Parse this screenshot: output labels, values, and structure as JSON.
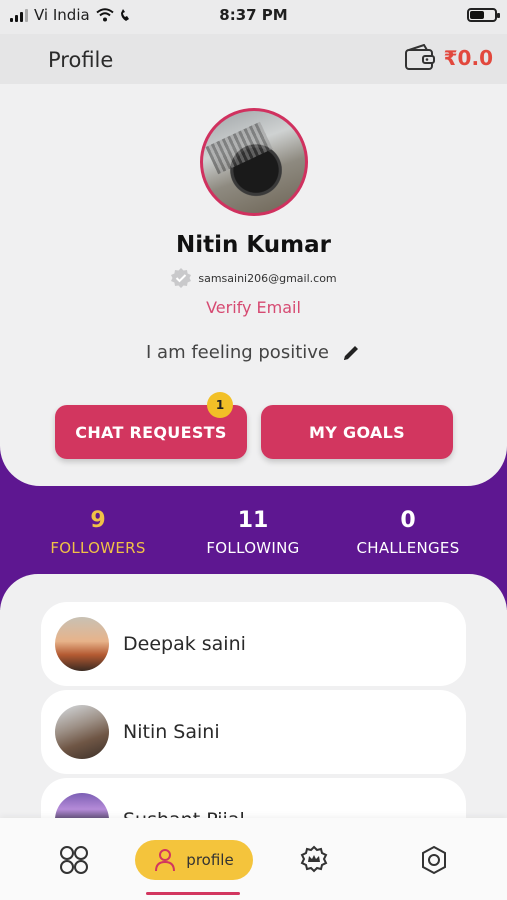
{
  "status_bar": {
    "carrier": "Vi India",
    "time": "8:37 PM",
    "battery_level": 0.6
  },
  "header": {
    "title": "Profile",
    "wallet_icon": "wallet-icon",
    "wallet_amount": "₹0.0"
  },
  "profile": {
    "name": "Nitin Kumar",
    "email": "samsaini206@gmail.com",
    "verify_label": "Verify Email",
    "bio": "I am feeling positive",
    "chat_requests_label": "CHAT REQUESTS",
    "chat_requests_badge": "1",
    "my_goals_label": "MY GOALS"
  },
  "stats": [
    {
      "count": "9",
      "label": "FOLLOWERS"
    },
    {
      "count": "11",
      "label": "FOLLOWING"
    },
    {
      "count": "0",
      "label": "CHALLENGES"
    }
  ],
  "list": [
    {
      "name": "Deepak saini"
    },
    {
      "name": "Nitin Saini"
    },
    {
      "name": "Sushant Pijal"
    }
  ],
  "nav": {
    "profile_label": "profile"
  },
  "colors": {
    "accent": "#d2365f",
    "purple": "#5e1791",
    "highlight": "#f1c146",
    "wallet": "#e2483d"
  }
}
